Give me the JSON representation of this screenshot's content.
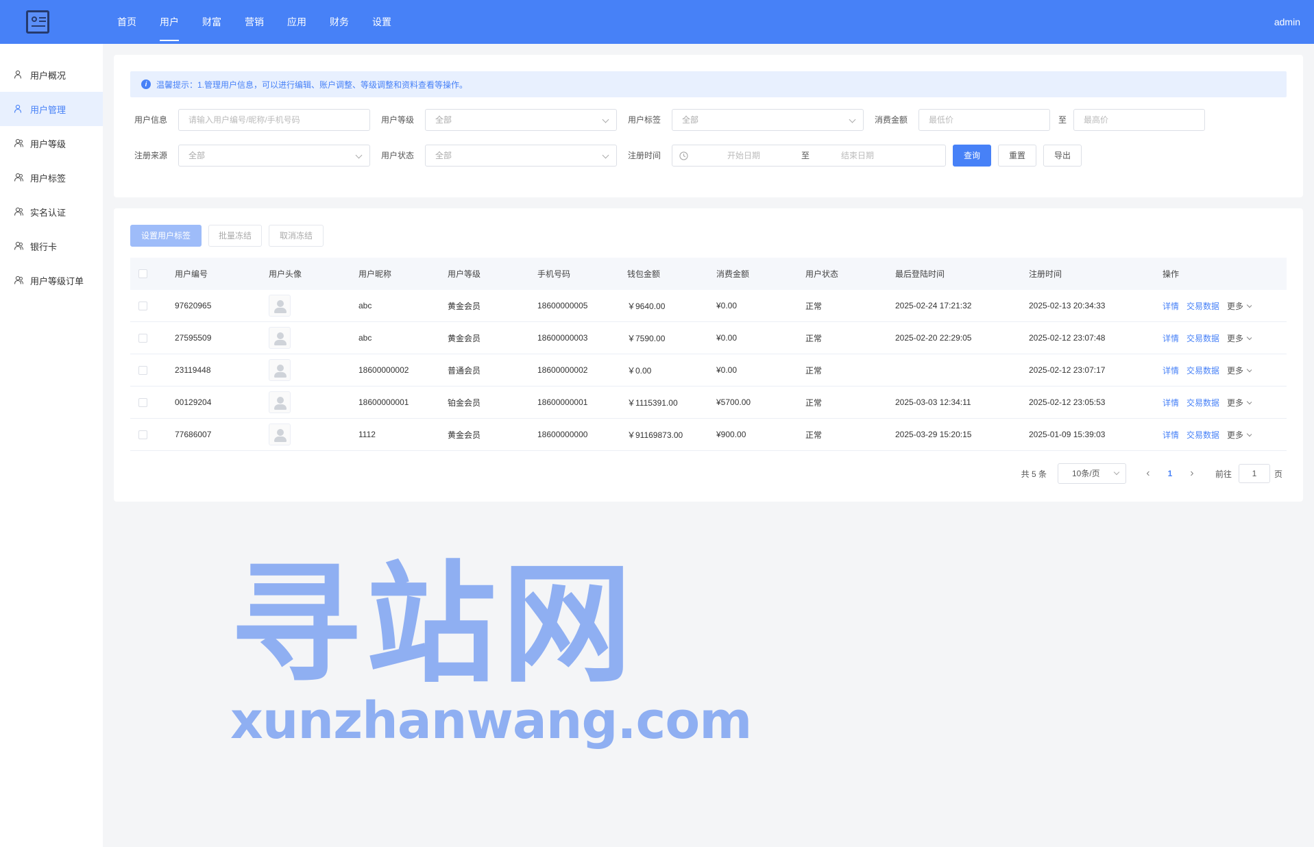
{
  "header": {
    "nav": [
      "首页",
      "用户",
      "财富",
      "营销",
      "应用",
      "财务",
      "设置"
    ],
    "active_nav": 1,
    "user": "admin"
  },
  "sidebar": {
    "items": [
      {
        "label": "用户概况",
        "icon": "user-icon"
      },
      {
        "label": "用户管理",
        "icon": "user-manage-icon"
      },
      {
        "label": "用户等级",
        "icon": "users-icon"
      },
      {
        "label": "用户标签",
        "icon": "user-tag-icon"
      },
      {
        "label": "实名认证",
        "icon": "user-verify-icon"
      },
      {
        "label": "银行卡",
        "icon": "bank-card-icon"
      },
      {
        "label": "用户等级订单",
        "icon": "users-order-icon"
      }
    ],
    "active": 1
  },
  "tip": {
    "icon": "info-icon",
    "text": "温馨提示：1.管理用户信息，可以进行编辑、账户调整、等级调整和资料查看等操作。"
  },
  "filters": {
    "user_info_label": "用户信息",
    "user_info_placeholder": "请输入用户编号/昵称/手机号码",
    "user_level_label": "用户等级",
    "user_level_value": "全部",
    "user_tag_label": "用户标签",
    "user_tag_value": "全部",
    "spend_label": "消费金额",
    "spend_min_placeholder": "最低价",
    "spend_to": "至",
    "spend_max_placeholder": "最高价",
    "source_label": "注册来源",
    "source_value": "全部",
    "status_label": "用户状态",
    "status_value": "全部",
    "reg_time_label": "注册时间",
    "start_date_placeholder": "开始日期",
    "date_to": "至",
    "end_date_placeholder": "结束日期",
    "query_button": "查询",
    "reset_button": "重置",
    "export_button": "导出"
  },
  "actions": {
    "set_tag": "设置用户标签",
    "batch_freeze": "批量冻结",
    "unfreeze": "取消冻结"
  },
  "table": {
    "columns": [
      "用户编号",
      "用户头像",
      "用户昵称",
      "用户等级",
      "手机号码",
      "钱包金额",
      "消费金额",
      "用户状态",
      "最后登陆时间",
      "注册时间",
      "操作"
    ],
    "rows": [
      {
        "id": "97620965",
        "nickname": "abc",
        "level": "黄金会员",
        "phone": "18600000005",
        "wallet": "￥9640.00",
        "spend": "¥0.00",
        "status": "正常",
        "last_login": "2025-02-24 17:21:32",
        "reg_time": "2025-02-13 20:34:33"
      },
      {
        "id": "27595509",
        "nickname": "abc",
        "level": "黄金会员",
        "phone": "18600000003",
        "wallet": "￥7590.00",
        "spend": "¥0.00",
        "status": "正常",
        "last_login": "2025-02-20 22:29:05",
        "reg_time": "2025-02-12 23:07:48"
      },
      {
        "id": "23119448",
        "nickname": "18600000002",
        "level": "普通会员",
        "phone": "18600000002",
        "wallet": "￥0.00",
        "spend": "¥0.00",
        "status": "正常",
        "last_login": "",
        "reg_time": "2025-02-12 23:07:17"
      },
      {
        "id": "00129204",
        "nickname": "18600000001",
        "level": "铂金会员",
        "phone": "18600000001",
        "wallet": "￥1115391.00",
        "spend": "¥5700.00",
        "status": "正常",
        "last_login": "2025-03-03 12:34:11",
        "reg_time": "2025-02-12 23:05:53"
      },
      {
        "id": "77686007",
        "nickname": "1112",
        "level": "黄金会员",
        "phone": "18600000000",
        "wallet": "￥91169873.00",
        "spend": "¥900.00",
        "status": "正常",
        "last_login": "2025-03-29 15:20:15",
        "reg_time": "2025-01-09 15:39:03"
      }
    ],
    "ops": {
      "detail": "详情",
      "trade": "交易数据",
      "more": "更多"
    }
  },
  "pagination": {
    "total": "共 5 条",
    "page_size": "10条/页",
    "current": "1",
    "goto_label": "前往",
    "goto_value": "1",
    "page_suffix": "页"
  },
  "watermark": {
    "cn": "寻站网",
    "en": "xunzhanwang.com"
  },
  "colors": {
    "primary": "#4781f7",
    "background": "#f4f5f7"
  }
}
